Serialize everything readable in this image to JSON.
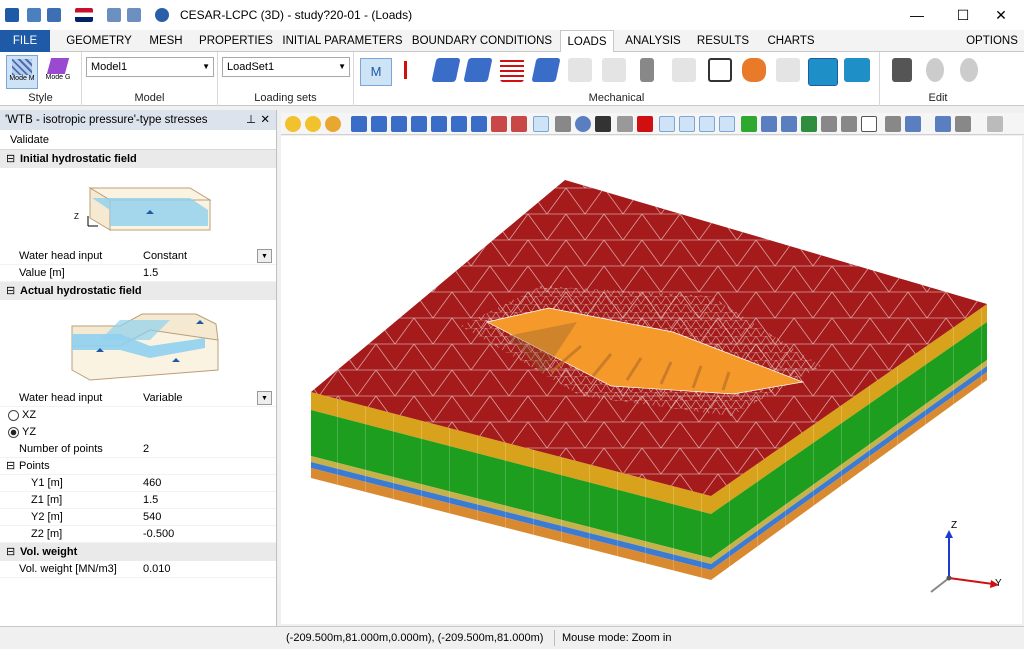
{
  "window": {
    "title": "CESAR-LCPC (3D) - study?20-01 - (Loads)",
    "minimize": "—",
    "maximize": "☐",
    "close": "✕"
  },
  "ribbon_tabs": {
    "file": "FILE",
    "tabs": [
      "GEOMETRY",
      "MESH",
      "PROPERTIES",
      "INITIAL PARAMETERS",
      "BOUNDARY CONDITIONS",
      "LOADS",
      "ANALYSIS",
      "RESULTS",
      "CHARTS"
    ],
    "options": "OPTIONS"
  },
  "ribbon": {
    "style": {
      "label": "Style",
      "mode_m": "Mode M",
      "mode_g": "Mode G"
    },
    "model": {
      "label": "Model",
      "value": "Model1"
    },
    "loading_sets": {
      "label": "Loading sets",
      "value": "LoadSet1"
    },
    "mechanical": {
      "label": "Mechanical",
      "m_button": "M"
    },
    "edit": {
      "label": "Edit"
    }
  },
  "panel": {
    "title": "'WTB - isotropic pressure'-type stresses",
    "pin": "⊥",
    "close": "✕",
    "validate": "Validate",
    "initial": {
      "header": "Initial hydrostatic field",
      "axis_label": "Z",
      "water_head_input_label": "Water head input",
      "water_head_input_value": "Constant",
      "value_label": "Value [m]",
      "value_value": "1.5"
    },
    "actual": {
      "header": "Actual hydrostatic field",
      "water_head_input_label": "Water head input",
      "water_head_input_value": "Variable",
      "radio_xz": "XZ",
      "radio_yz": "YZ",
      "num_points_label": "Number of points",
      "num_points_value": "2",
      "points_label": "Points",
      "y1_label": "Y1 [m]",
      "y1_value": "460",
      "z1_label": "Z1 [m]",
      "z1_value": "1.5",
      "y2_label": "Y2 [m]",
      "y2_value": "540",
      "z2_label": "Z2 [m]",
      "z2_value": "-0.500"
    },
    "vol_weight": {
      "header": "Vol. weight",
      "label": "Vol. weight [MN/m3]",
      "value": "0.010"
    }
  },
  "axes": {
    "z": "Z",
    "y": "Y"
  },
  "status": {
    "coords": "(-209.500m,81.000m,0.000m), (-209.500m,81.000m)",
    "mode": "Mouse mode: Zoom in"
  },
  "colors": {
    "accent": "#1e5aa8",
    "top_face": "#a51a1a",
    "excavation": "#f59a2a",
    "layer_yellow": "#d9a21c",
    "layer_green": "#1e9e1e",
    "layer_blue": "#3b7bd4"
  }
}
